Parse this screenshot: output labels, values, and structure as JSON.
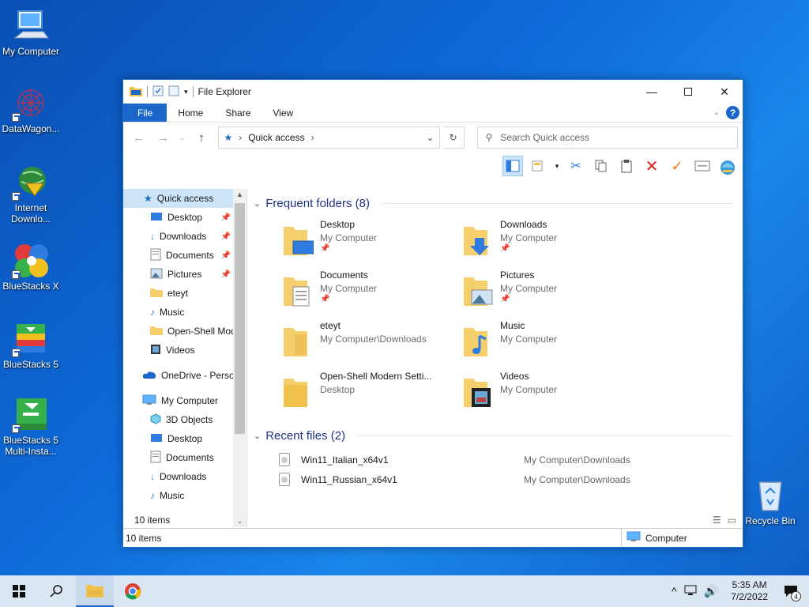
{
  "desktop": {
    "icons": [
      {
        "label": "My Computer"
      },
      {
        "label": "DataWagon..."
      },
      {
        "label": "Internet Downlo..."
      },
      {
        "label": "BlueStacks X"
      },
      {
        "label": "BlueStacks 5"
      },
      {
        "label": "BlueStacks 5 Multi-Insta..."
      },
      {
        "label": "Recycle Bin"
      }
    ]
  },
  "window": {
    "title": "File Explorer",
    "tabs": {
      "file": "File",
      "home": "Home",
      "share": "Share",
      "view": "View"
    },
    "address": {
      "location": "Quick access"
    },
    "search": {
      "placeholder": "Search Quick access"
    },
    "nav": {
      "quick_access": "Quick access",
      "items": [
        "Desktop",
        "Downloads",
        "Documents",
        "Pictures",
        "eteyt",
        "Music",
        "Open-Shell Mod",
        "Videos"
      ],
      "onedrive": "OneDrive - Persor",
      "my_computer": "My Computer",
      "computer_items": [
        "3D Objects",
        "Desktop",
        "Documents",
        "Downloads",
        "Music"
      ]
    },
    "frequent": {
      "header": "Frequent folders (8)",
      "folders": [
        {
          "name": "Desktop",
          "location": "My Computer"
        },
        {
          "name": "Downloads",
          "location": "My Computer"
        },
        {
          "name": "Documents",
          "location": "My Computer"
        },
        {
          "name": "Pictures",
          "location": "My Computer"
        },
        {
          "name": "eteyt",
          "location": "My Computer\\Downloads"
        },
        {
          "name": "Music",
          "location": "My Computer"
        },
        {
          "name": "Open-Shell Modern Setti...",
          "location": "Desktop"
        },
        {
          "name": "Videos",
          "location": "My Computer"
        }
      ]
    },
    "recent": {
      "header": "Recent files (2)",
      "files": [
        {
          "name": "Win11_Italian_x64v1",
          "path": "My Computer\\Downloads"
        },
        {
          "name": "Win11_Russian_x64v1",
          "path": "My Computer\\Downloads"
        }
      ]
    },
    "status": {
      "inner_count": "10 items",
      "outer_count": "10 items",
      "computer": "Computer"
    }
  },
  "taskbar": {
    "time": "5:35 AM",
    "date": "7/2/2022",
    "notifications": "4"
  }
}
